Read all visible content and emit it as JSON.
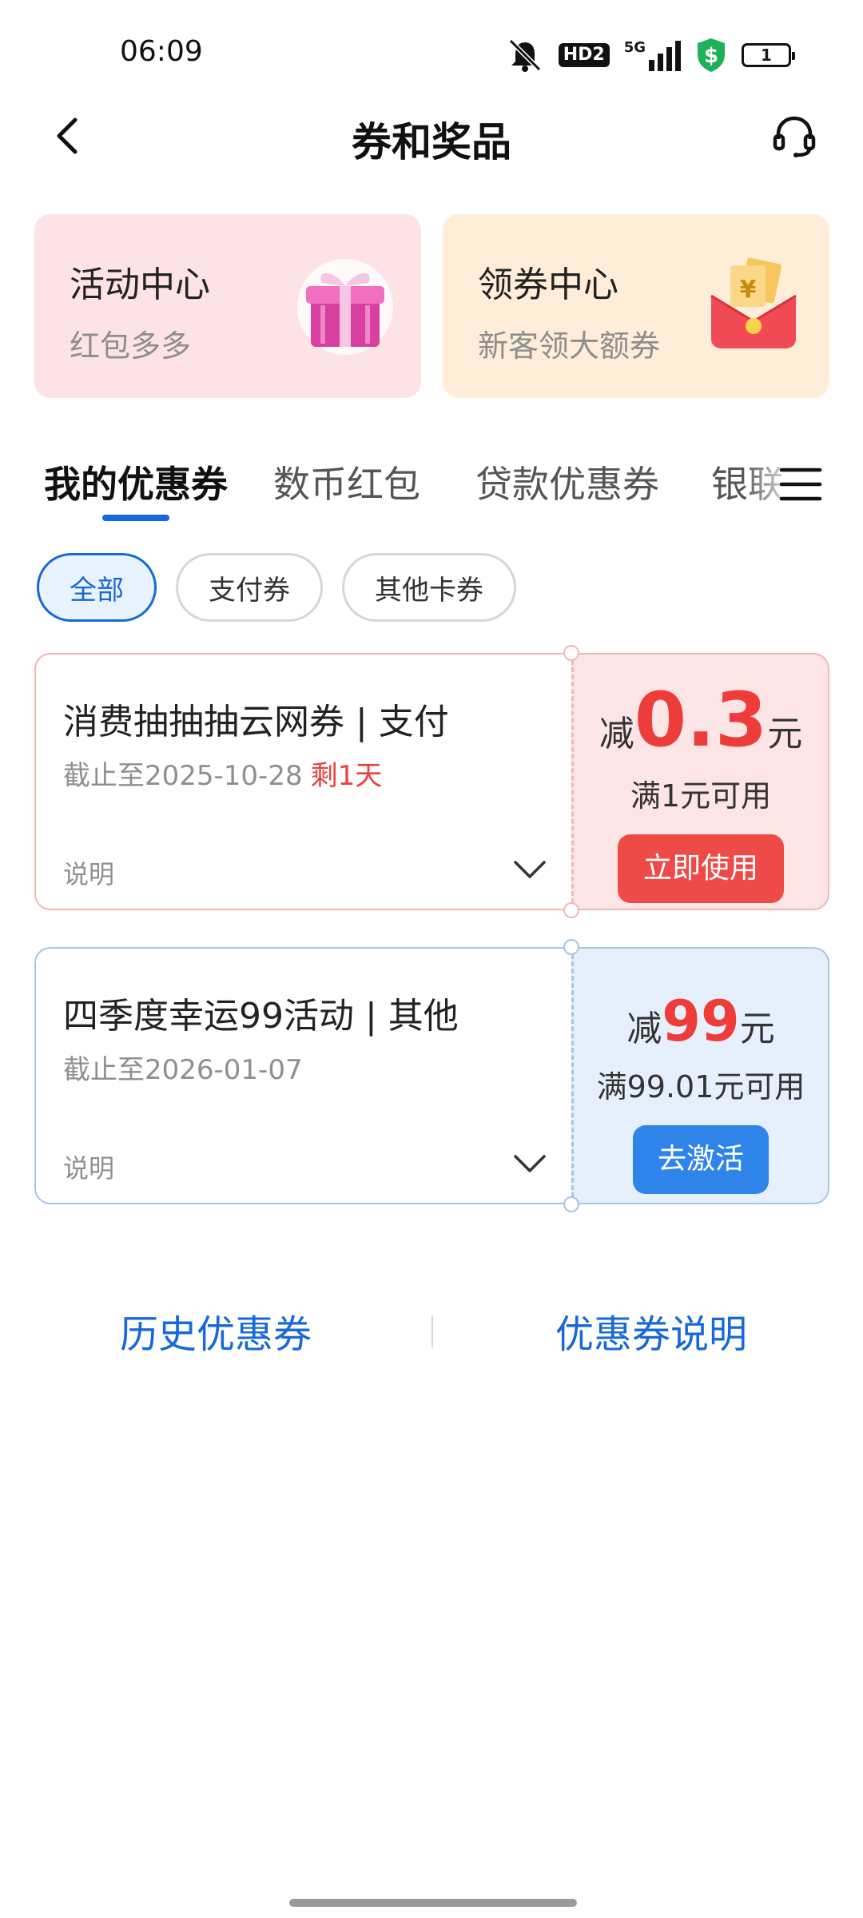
{
  "status_bar": {
    "time": "06:09",
    "hd_label": "HD2",
    "network": "5G",
    "battery": "1"
  },
  "header": {
    "title": "券和奖品",
    "back_icon": "chevron-left-icon",
    "support_icon": "headset-icon"
  },
  "promo_cards": [
    {
      "title": "活动中心",
      "subtitle": "红包多多",
      "icon": "gift-box-icon"
    },
    {
      "title": "领券中心",
      "subtitle": "新客领大额券",
      "icon": "red-envelope-icon"
    }
  ],
  "tabs": [
    {
      "label": "我的优惠券",
      "active": true
    },
    {
      "label": "数币红包",
      "active": false
    },
    {
      "label": "贷款优惠券",
      "active": false
    },
    {
      "label": "银联",
      "active": false
    }
  ],
  "filters": [
    {
      "label": "全部",
      "active": true
    },
    {
      "label": "支付券",
      "active": false
    },
    {
      "label": "其他卡券",
      "active": false
    }
  ],
  "coupons": [
    {
      "title": "消费抽抽抽云网券 | 支付",
      "expiry": "截止至2025-10-28",
      "remaining": "剩1天",
      "note": "说明",
      "prefix": "减",
      "amount": "0.3",
      "unit": "元",
      "condition": "满1元可用",
      "button": "立即使用",
      "color": "#ee4a47"
    },
    {
      "title": "四季度幸运99活动 | 其他",
      "expiry": "截止至2026-01-07",
      "remaining": "",
      "note": "说明",
      "prefix": "减",
      "amount": "99",
      "unit": "元",
      "condition": "满99.01元可用",
      "button": "去激活",
      "color": "#2f84ea"
    }
  ],
  "bottom_links": {
    "history": "历史优惠券",
    "explanation": "优惠券说明"
  },
  "colors": {
    "accent_blue": "#1768d8",
    "accent_red": "#ee3c3a"
  }
}
